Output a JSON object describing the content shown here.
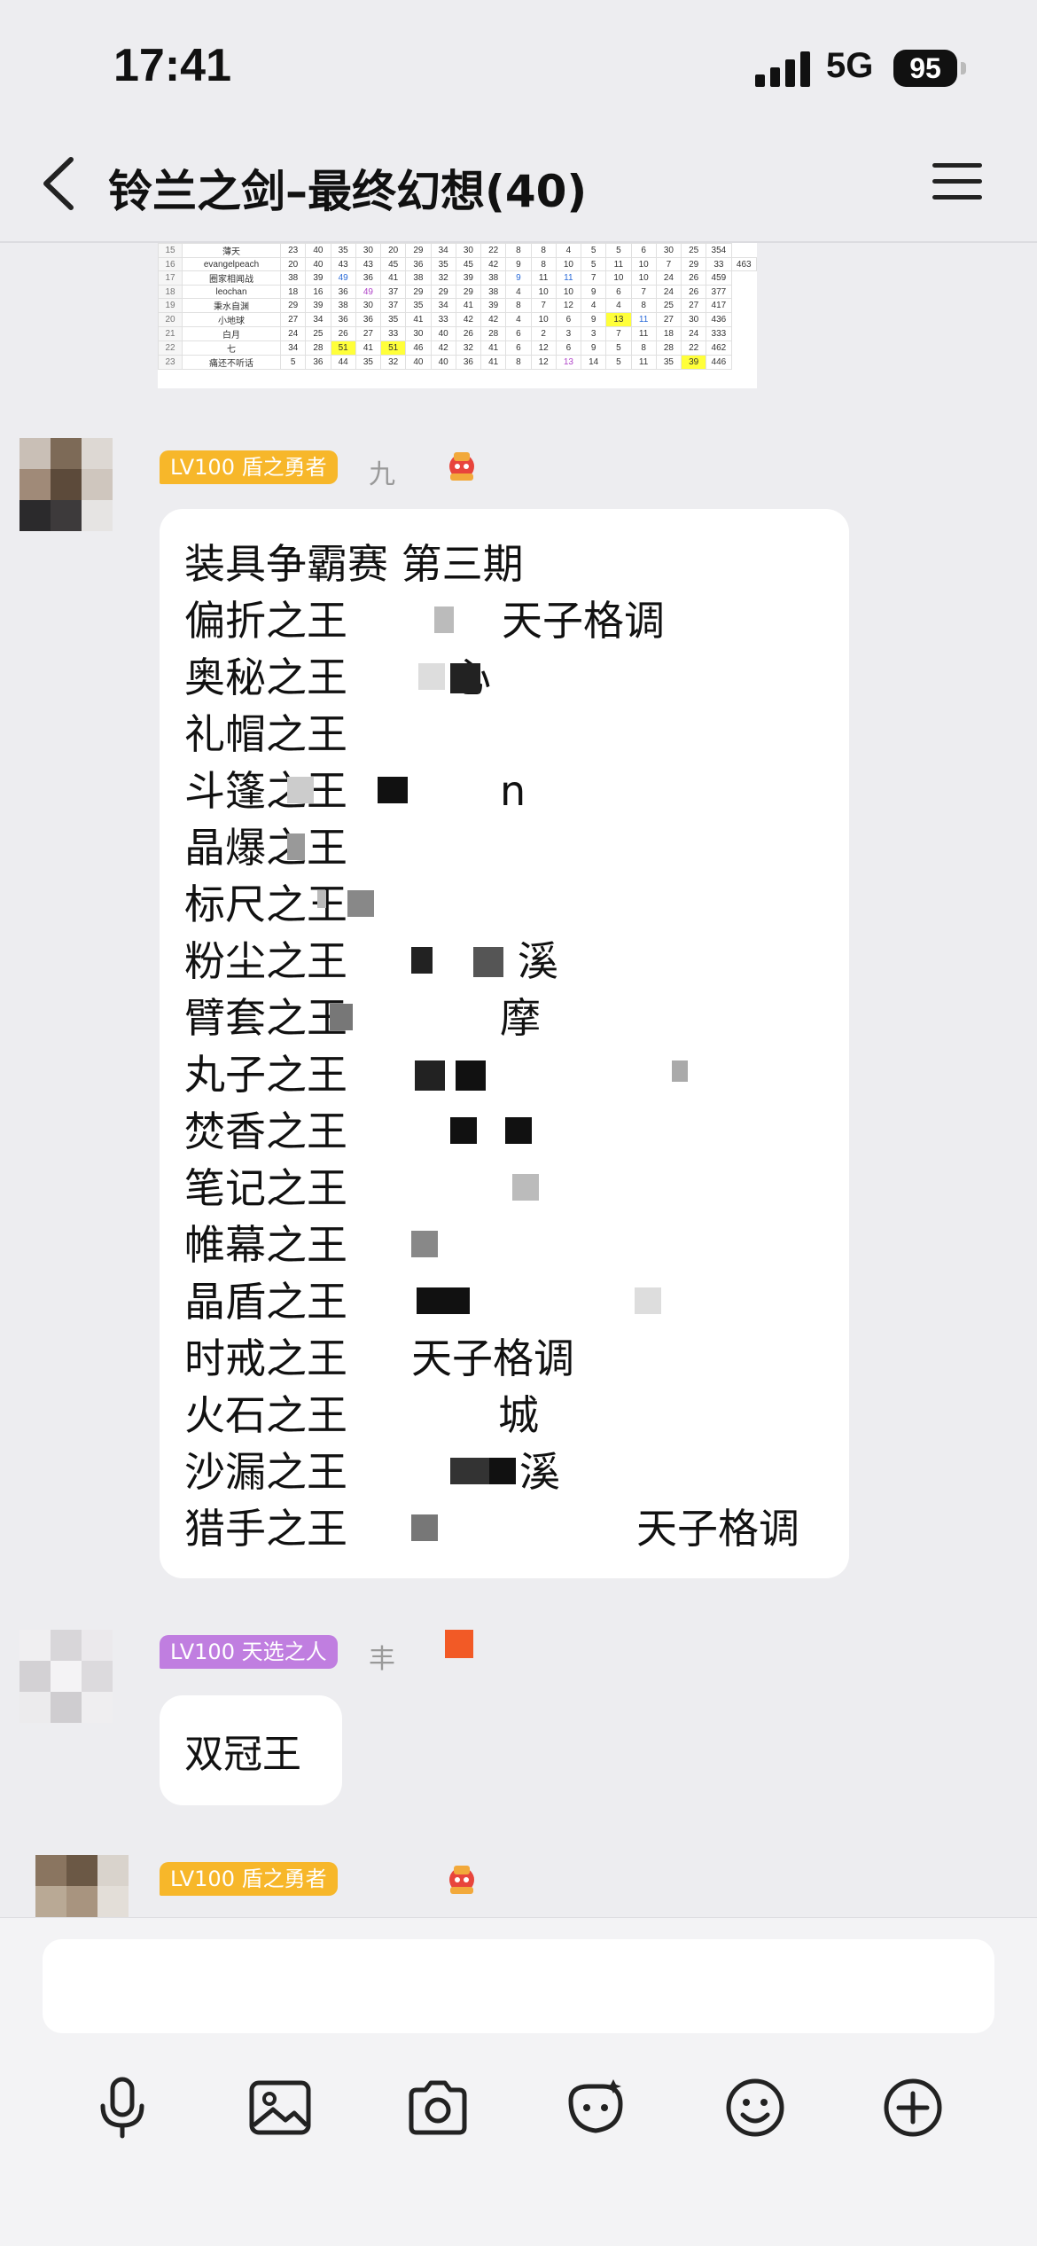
{
  "status_bar": {
    "time": "17:41",
    "network": "5G",
    "battery": "95"
  },
  "header": {
    "title": "铃兰之剑–最终幻想(40)"
  },
  "table_image": {
    "rows": [
      {
        "n": "15",
        "name": "薄天",
        "v": [
          "23",
          "40",
          "35",
          "30",
          "20",
          "29",
          "34",
          "30",
          "22",
          "8",
          "8",
          "4",
          "5",
          "5",
          "6",
          "30",
          "25",
          "354"
        ]
      },
      {
        "n": "16",
        "name": "evangelpeach",
        "v": [
          "20",
          "40",
          "43",
          "43",
          "45",
          "36",
          "35",
          "45",
          "42",
          "9",
          "8",
          "10",
          "5",
          "11",
          "10",
          "7",
          "29",
          "33",
          "463"
        ]
      },
      {
        "n": "17",
        "name": "圈家相闻战",
        "v": [
          "38",
          "39",
          "49",
          "36",
          "41",
          "38",
          "32",
          "39",
          "38",
          "9",
          "11",
          "11",
          "7",
          "10",
          "10",
          "24",
          "26",
          "459"
        ]
      },
      {
        "n": "18",
        "name": "leochan",
        "v": [
          "18",
          "16",
          "36",
          "49",
          "37",
          "29",
          "29",
          "29",
          "38",
          "4",
          "10",
          "10",
          "9",
          "6",
          "7",
          "24",
          "26",
          "377"
        ]
      },
      {
        "n": "19",
        "name": "秉水自渊",
        "v": [
          "29",
          "39",
          "38",
          "30",
          "37",
          "35",
          "34",
          "41",
          "39",
          "8",
          "7",
          "12",
          "4",
          "4",
          "8",
          "25",
          "27",
          "417"
        ]
      },
      {
        "n": "20",
        "name": "小地球",
        "v": [
          "27",
          "34",
          "36",
          "36",
          "35",
          "41",
          "33",
          "42",
          "42",
          "4",
          "10",
          "6",
          "9",
          "13",
          "11",
          "27",
          "30",
          "436"
        ]
      },
      {
        "n": "21",
        "name": "白月",
        "v": [
          "24",
          "25",
          "26",
          "27",
          "33",
          "30",
          "40",
          "26",
          "28",
          "6",
          "2",
          "3",
          "3",
          "7",
          "11",
          "18",
          "24",
          "333"
        ]
      },
      {
        "n": "22",
        "name": "七",
        "v": [
          "34",
          "28",
          "51",
          "41",
          "51",
          "46",
          "42",
          "32",
          "41",
          "6",
          "12",
          "6",
          "9",
          "5",
          "8",
          "28",
          "22",
          "462"
        ]
      },
      {
        "n": "23",
        "name": "痛还不听话",
        "v": [
          "5",
          "36",
          "44",
          "35",
          "32",
          "40",
          "40",
          "36",
          "41",
          "8",
          "12",
          "13",
          "14",
          "5",
          "11",
          "35",
          "39",
          "446"
        ]
      }
    ]
  },
  "messages": [
    {
      "badge": "LV100 盾之勇者",
      "nick": "九",
      "bubble": {
        "heading": "装具争霸赛 第三期",
        "rows": [
          {
            "king": "偏折之王",
            "winner": "天子格调"
          },
          {
            "king": "奥秘之王",
            "winner": "心"
          },
          {
            "king": "礼帽之王",
            "winner": ""
          },
          {
            "king": "斗篷之王",
            "winner": "n"
          },
          {
            "king": "晶爆之王",
            "winner": ""
          },
          {
            "king": "标尺之王",
            "winner": ""
          },
          {
            "king": "粉尘之王",
            "winner": "溪"
          },
          {
            "king": "臂套之王",
            "winner": "摩"
          },
          {
            "king": "丸子之王",
            "winner": ""
          },
          {
            "king": "焚香之王",
            "winner": ""
          },
          {
            "king": "笔记之王",
            "winner": ""
          },
          {
            "king": "帷幕之王",
            "winner": ""
          },
          {
            "king": "晶盾之王",
            "winner": ""
          },
          {
            "king": "时戒之王",
            "winner": "天子格调"
          },
          {
            "king": "火石之王",
            "winner": "城"
          },
          {
            "king": "沙漏之王",
            "winner": "溪"
          },
          {
            "king": "猎手之王",
            "winner": "天子格调"
          }
        ]
      }
    },
    {
      "badge": "LV100 天选之人",
      "nick": "丰",
      "bubble_text": "双冠王"
    },
    {
      "badge": "LV100 盾之勇者",
      "nick": ""
    }
  ],
  "icons": [
    "microphone-icon",
    "image-icon",
    "camera-icon",
    "sticker-icon",
    "emoji-icon",
    "add-icon"
  ],
  "colors": {
    "gold_badge": "#f7b72a",
    "purple_badge": "#c07ee0",
    "highlight": "#ffff3a"
  }
}
